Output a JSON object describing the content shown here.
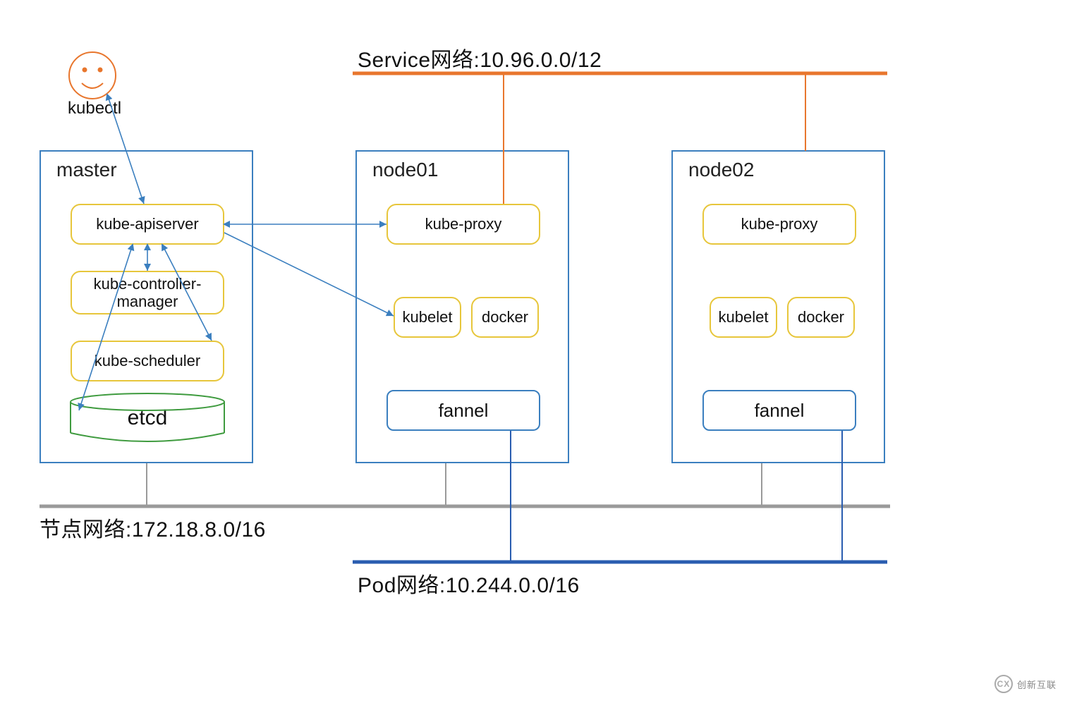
{
  "networks": {
    "service": {
      "label": "Service网络:10.96.0.0/12",
      "color": "#e8762d"
    },
    "node": {
      "label": "节点网络:172.18.8.0/16",
      "color": "#9a9a9a"
    },
    "pod": {
      "label": "Pod网络:10.244.0.0/16",
      "color": "#2a5db0"
    }
  },
  "client": {
    "name": "kubectl",
    "icon": "smile-icon",
    "icon_color": "#e8762d"
  },
  "nodes": {
    "master": {
      "title": "master",
      "components": {
        "apiserver": "kube-apiserver",
        "controller": "kube-controller-manager",
        "scheduler": "kube-scheduler",
        "etcd": "etcd"
      }
    },
    "node01": {
      "title": "node01",
      "components": {
        "proxy": "kube-proxy",
        "kubelet": "kubelet",
        "docker": "docker",
        "flannel": "fannel"
      }
    },
    "node02": {
      "title": "node02",
      "components": {
        "proxy": "kube-proxy",
        "kubelet": "kubelet",
        "docker": "docker",
        "flannel": "fannel"
      }
    }
  },
  "arrows": {
    "style_color": "#3b7fbf",
    "edges": [
      "kubectl ↔ kube-apiserver",
      "kube-apiserver ↔ kube-proxy (node01)",
      "kube-apiserver → kubelet (node01)",
      "kube-apiserver ↔ kube-controller-manager",
      "kube-apiserver ↔ kube-scheduler",
      "kube-apiserver ↔ etcd"
    ]
  },
  "watermark": {
    "brand": "创新互联",
    "icon_text": "CX"
  }
}
